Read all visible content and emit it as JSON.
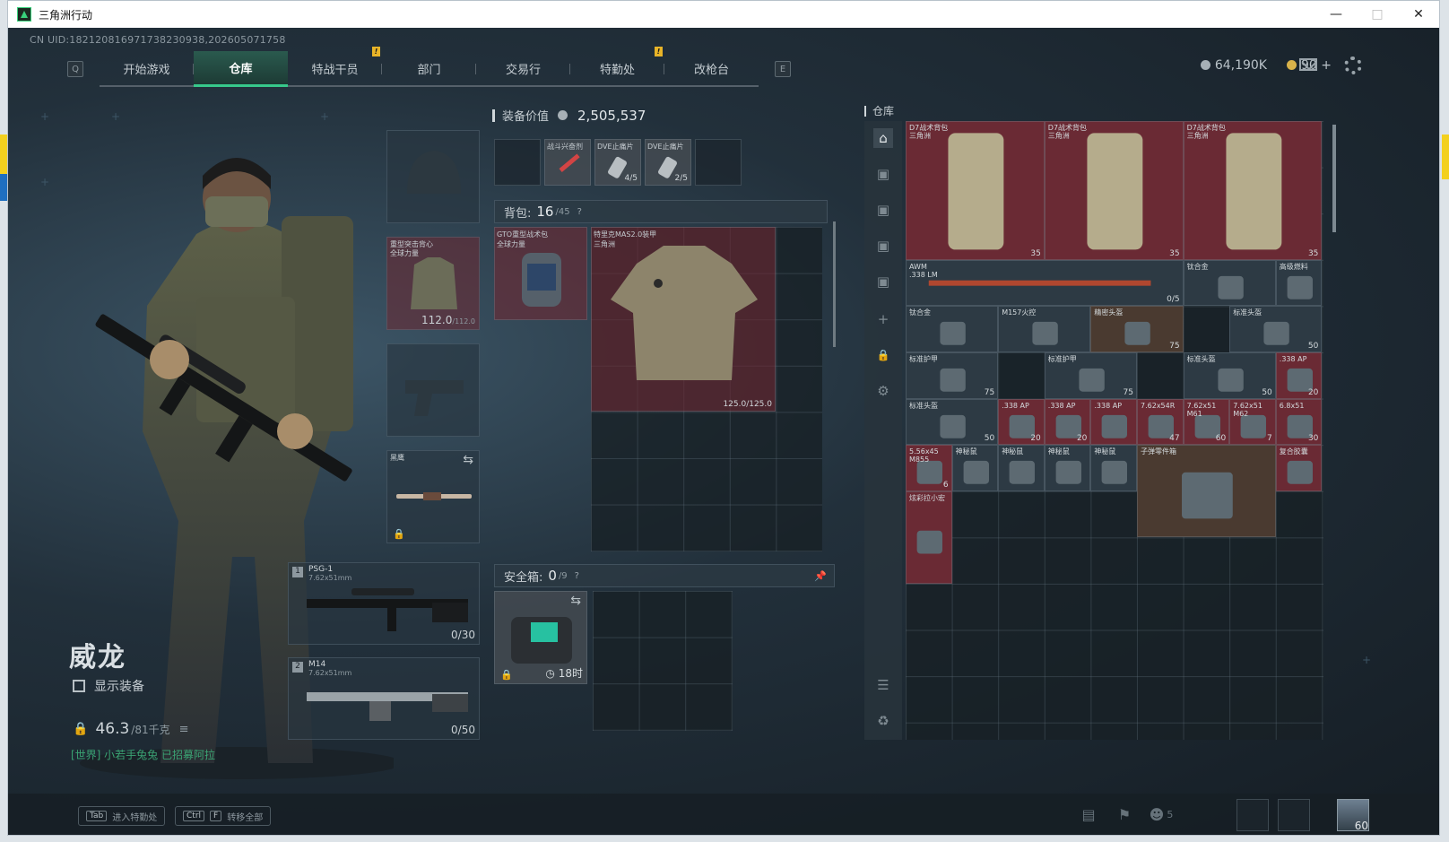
{
  "window": {
    "title": "三角洲行动"
  },
  "uid": "CN UID:1821208169717382309​38,202605071758",
  "nav": {
    "left_key": "Q",
    "right_key": "E",
    "tabs": [
      {
        "label": "开始游戏",
        "active": false
      },
      {
        "label": "仓库",
        "active": true
      },
      {
        "label": "特战干员",
        "active": false,
        "badge": "!"
      },
      {
        "label": "部门",
        "active": false
      },
      {
        "label": "交易行",
        "active": false
      },
      {
        "label": "特勤处",
        "active": false,
        "badge": "!"
      },
      {
        "label": "改枪台",
        "active": false
      }
    ]
  },
  "currency": {
    "silver": "64,190K",
    "gold": "90",
    "gold_plus": "+"
  },
  "character": {
    "name": "威龙",
    "show_equip_label": "显示装备",
    "weight_current": "46.3",
    "weight_max": "/81千克",
    "chat_text": "[世界] 小若手兔兔 已招募阿拉"
  },
  "equip_slots": {
    "armor": {
      "label1": "重型突击背心",
      "label2": "全球力量",
      "value": "112.0",
      "max": "/112.0"
    },
    "melee": {
      "label": "黑鹰"
    },
    "primary": {
      "index": "1",
      "name": "PSG-1",
      "caliber": "7.62x51mm",
      "ammo": "0/30"
    },
    "secondary": {
      "index": "2",
      "name": "M14",
      "caliber": "7.62x51mm",
      "ammo": "0/50"
    }
  },
  "loadout": {
    "equip_value_label": "装备价值",
    "equip_value": "2,505,537",
    "quick_slots": [
      {
        "label": "",
        "count": ""
      },
      {
        "label": "战斗兴奋剂",
        "count": ""
      },
      {
        "label": "DVE止痛片",
        "count": "4/5"
      },
      {
        "label": "DVE止痛片",
        "count": "2/5"
      },
      {
        "label": "",
        "count": ""
      }
    ],
    "backpack_label": "背包:",
    "backpack_used": "16",
    "backpack_cap": "/45",
    "backpack_help": "?",
    "backpack_item": {
      "label1": "GTO重型战术包",
      "label2": "全球力量"
    },
    "armor_item": {
      "label1": "特里克MAS2.0装甲",
      "label2": "三角洲",
      "durability": "125.0/125.0"
    },
    "safebox_label": "安全箱:",
    "safebox_used": "0",
    "safebox_cap": "/9",
    "safebox_help": "?",
    "safebox_timer": "18时"
  },
  "warehouse": {
    "title": "仓库",
    "items": [
      {
        "label": "D7战术背包",
        "sub": "三角洲",
        "count": "35",
        "color": "#6a2a34"
      },
      {
        "label": "D7战术背包",
        "sub": "三角洲",
        "count": "35",
        "color": "#6a2a34"
      },
      {
        "label": "D7战术背包",
        "sub": "三角洲",
        "count": "35",
        "color": "#6a2a34"
      },
      {
        "label": "AWM",
        "sub": ".338 LM",
        "count": "0/5",
        "color": "#2d3a44"
      },
      {
        "label": "钛合金",
        "sub": "",
        "count": "",
        "color": "#2d3a44"
      },
      {
        "label": "高级燃料",
        "sub": "",
        "count": "",
        "color": "#2d3a44"
      },
      {
        "label": "钛合金",
        "sub": "",
        "count": "",
        "color": "#2d3a44"
      },
      {
        "label": "M157火控",
        "sub": "",
        "count": "",
        "color": "#2d3a44"
      },
      {
        "label": "精密头盔",
        "sub": "",
        "count": "75",
        "color": "#4a3a30"
      },
      {
        "label": "标准头盔",
        "sub": "",
        "count": "50",
        "color": "#2d3a44"
      },
      {
        "label": "标准护甲",
        "sub": "",
        "count": "75",
        "color": "#2d3a44"
      },
      {
        "label": "标准护甲",
        "sub": "",
        "count": "75",
        "color": "#2d3a44"
      },
      {
        "label": "标准头盔",
        "sub": "",
        "count": "50",
        "color": "#2d3a44"
      },
      {
        "label": ".338 AP",
        "sub": "",
        "count": "20",
        "color": "#6a2a34"
      },
      {
        "label": "标准头盔",
        "sub": "",
        "count": "50",
        "color": "#2d3a44"
      },
      {
        "label": ".338 AP",
        "sub": "",
        "count": "20",
        "color": "#6a2a34"
      },
      {
        "label": ".338 AP",
        "sub": "",
        "count": "20",
        "color": "#6a2a34"
      },
      {
        "label": ".338 AP",
        "sub": "",
        "count": "",
        "color": "#6a2a34"
      },
      {
        "label": "7.62x54R",
        "sub": "",
        "count": "47",
        "color": "#6a2a34"
      },
      {
        "label": "7.62x51 M61",
        "sub": "",
        "count": "60",
        "color": "#6a2a34"
      },
      {
        "label": "7.62x51 M62",
        "sub": "",
        "count": "7",
        "color": "#6a2a34"
      },
      {
        "label": "6.8x51",
        "sub": "",
        "count": "30",
        "color": "#6a2a34"
      },
      {
        "label": "5.56x45 M855",
        "sub": "",
        "count": "6",
        "color": "#6a2a34"
      },
      {
        "label": "神秘鼠",
        "sub": "",
        "count": "",
        "color": "#2d3a44"
      },
      {
        "label": "神秘鼠",
        "sub": "",
        "count": "",
        "color": "#2d3a44"
      },
      {
        "label": "神秘鼠",
        "sub": "",
        "count": "",
        "color": "#2d3a44"
      },
      {
        "label": "神秘鼠",
        "sub": "",
        "count": "",
        "color": "#2d3a44"
      },
      {
        "label": "子弹零件箱",
        "sub": "",
        "count": "",
        "color": "#4a3a30"
      },
      {
        "label": "复合胶囊",
        "sub": "",
        "count": "",
        "color": "#6a2a34"
      },
      {
        "label": "炫彩拉小宏",
        "sub": "",
        "count": "",
        "color": "#6a2a34"
      }
    ]
  },
  "bottom": {
    "hint1_key": "Tab",
    "hint1_text": "进入特勤处",
    "hint2_key1": "Ctrl",
    "hint2_key2": "F",
    "hint2_text": "转移全部",
    "friends_count": "5",
    "level": "60"
  },
  "icons": [
    "app-logo-icon",
    "mail-icon",
    "settings-icon",
    "lock-icon",
    "swap-icon",
    "pin-icon",
    "chart-icon",
    "flag-icon",
    "friends-icon",
    "warehouse-icon",
    "layers-icon",
    "recycle-icon",
    "plus-icon",
    "gear-icon"
  ],
  "colors": {
    "accent": "#37c98b",
    "warn": "#e8b428",
    "rare_bg": "#6a2a34",
    "panel_bg": "#151d24"
  }
}
